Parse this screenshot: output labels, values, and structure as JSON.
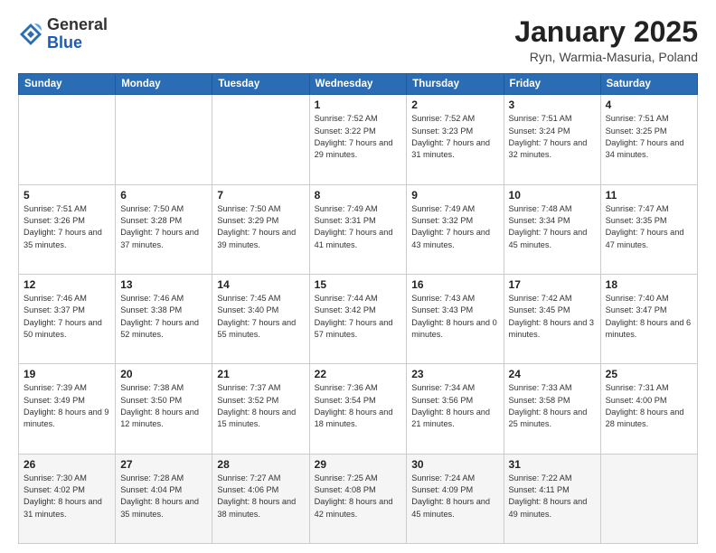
{
  "header": {
    "logo_general": "General",
    "logo_blue": "Blue",
    "month_title": "January 2025",
    "location": "Ryn, Warmia-Masuria, Poland"
  },
  "weekdays": [
    "Sunday",
    "Monday",
    "Tuesday",
    "Wednesday",
    "Thursday",
    "Friday",
    "Saturday"
  ],
  "weeks": [
    [
      {
        "day": "",
        "info": ""
      },
      {
        "day": "",
        "info": ""
      },
      {
        "day": "",
        "info": ""
      },
      {
        "day": "1",
        "info": "Sunrise: 7:52 AM\nSunset: 3:22 PM\nDaylight: 7 hours and 29 minutes."
      },
      {
        "day": "2",
        "info": "Sunrise: 7:52 AM\nSunset: 3:23 PM\nDaylight: 7 hours and 31 minutes."
      },
      {
        "day": "3",
        "info": "Sunrise: 7:51 AM\nSunset: 3:24 PM\nDaylight: 7 hours and 32 minutes."
      },
      {
        "day": "4",
        "info": "Sunrise: 7:51 AM\nSunset: 3:25 PM\nDaylight: 7 hours and 34 minutes."
      }
    ],
    [
      {
        "day": "5",
        "info": "Sunrise: 7:51 AM\nSunset: 3:26 PM\nDaylight: 7 hours and 35 minutes."
      },
      {
        "day": "6",
        "info": "Sunrise: 7:50 AM\nSunset: 3:28 PM\nDaylight: 7 hours and 37 minutes."
      },
      {
        "day": "7",
        "info": "Sunrise: 7:50 AM\nSunset: 3:29 PM\nDaylight: 7 hours and 39 minutes."
      },
      {
        "day": "8",
        "info": "Sunrise: 7:49 AM\nSunset: 3:31 PM\nDaylight: 7 hours and 41 minutes."
      },
      {
        "day": "9",
        "info": "Sunrise: 7:49 AM\nSunset: 3:32 PM\nDaylight: 7 hours and 43 minutes."
      },
      {
        "day": "10",
        "info": "Sunrise: 7:48 AM\nSunset: 3:34 PM\nDaylight: 7 hours and 45 minutes."
      },
      {
        "day": "11",
        "info": "Sunrise: 7:47 AM\nSunset: 3:35 PM\nDaylight: 7 hours and 47 minutes."
      }
    ],
    [
      {
        "day": "12",
        "info": "Sunrise: 7:46 AM\nSunset: 3:37 PM\nDaylight: 7 hours and 50 minutes."
      },
      {
        "day": "13",
        "info": "Sunrise: 7:46 AM\nSunset: 3:38 PM\nDaylight: 7 hours and 52 minutes."
      },
      {
        "day": "14",
        "info": "Sunrise: 7:45 AM\nSunset: 3:40 PM\nDaylight: 7 hours and 55 minutes."
      },
      {
        "day": "15",
        "info": "Sunrise: 7:44 AM\nSunset: 3:42 PM\nDaylight: 7 hours and 57 minutes."
      },
      {
        "day": "16",
        "info": "Sunrise: 7:43 AM\nSunset: 3:43 PM\nDaylight: 8 hours and 0 minutes."
      },
      {
        "day": "17",
        "info": "Sunrise: 7:42 AM\nSunset: 3:45 PM\nDaylight: 8 hours and 3 minutes."
      },
      {
        "day": "18",
        "info": "Sunrise: 7:40 AM\nSunset: 3:47 PM\nDaylight: 8 hours and 6 minutes."
      }
    ],
    [
      {
        "day": "19",
        "info": "Sunrise: 7:39 AM\nSunset: 3:49 PM\nDaylight: 8 hours and 9 minutes."
      },
      {
        "day": "20",
        "info": "Sunrise: 7:38 AM\nSunset: 3:50 PM\nDaylight: 8 hours and 12 minutes."
      },
      {
        "day": "21",
        "info": "Sunrise: 7:37 AM\nSunset: 3:52 PM\nDaylight: 8 hours and 15 minutes."
      },
      {
        "day": "22",
        "info": "Sunrise: 7:36 AM\nSunset: 3:54 PM\nDaylight: 8 hours and 18 minutes."
      },
      {
        "day": "23",
        "info": "Sunrise: 7:34 AM\nSunset: 3:56 PM\nDaylight: 8 hours and 21 minutes."
      },
      {
        "day": "24",
        "info": "Sunrise: 7:33 AM\nSunset: 3:58 PM\nDaylight: 8 hours and 25 minutes."
      },
      {
        "day": "25",
        "info": "Sunrise: 7:31 AM\nSunset: 4:00 PM\nDaylight: 8 hours and 28 minutes."
      }
    ],
    [
      {
        "day": "26",
        "info": "Sunrise: 7:30 AM\nSunset: 4:02 PM\nDaylight: 8 hours and 31 minutes."
      },
      {
        "day": "27",
        "info": "Sunrise: 7:28 AM\nSunset: 4:04 PM\nDaylight: 8 hours and 35 minutes."
      },
      {
        "day": "28",
        "info": "Sunrise: 7:27 AM\nSunset: 4:06 PM\nDaylight: 8 hours and 38 minutes."
      },
      {
        "day": "29",
        "info": "Sunrise: 7:25 AM\nSunset: 4:08 PM\nDaylight: 8 hours and 42 minutes."
      },
      {
        "day": "30",
        "info": "Sunrise: 7:24 AM\nSunset: 4:09 PM\nDaylight: 8 hours and 45 minutes."
      },
      {
        "day": "31",
        "info": "Sunrise: 7:22 AM\nSunset: 4:11 PM\nDaylight: 8 hours and 49 minutes."
      },
      {
        "day": "",
        "info": ""
      }
    ]
  ]
}
